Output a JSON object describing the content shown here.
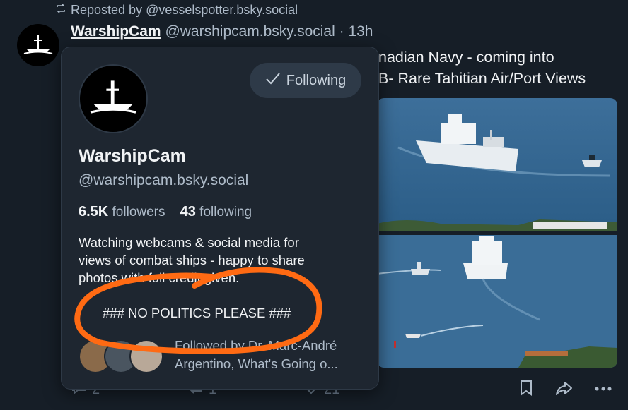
{
  "repost": {
    "label": "Reposted by @vesselspotter.bsky.social"
  },
  "post": {
    "display_name": "WarshipCam",
    "handle": "@warshipcam.bsky.social",
    "time": "· 13h",
    "text_line1": "nadian Navy - coming into",
    "text_line2": "B- Rare Tahitian Air/Port Views",
    "reply_count": "2",
    "repost_count": "1",
    "like_count": "21"
  },
  "profile_card": {
    "follow_label": "Following",
    "display_name": "WarshipCam",
    "handle": "@warshipcam.bsky.social",
    "followers_count": "6.5K",
    "followers_label": "followers",
    "following_count": "43",
    "following_label": "following",
    "bio_line1": "Watching webcams & social media for",
    "bio_line2": "views of combat ships - happy to share",
    "bio_line3": "photos with full credit given.",
    "bio_line4": "### NO POLITICS PLEASE ###",
    "followed_by_line1": "Followed by Dr. Marc-André",
    "followed_by_line2": "Argentino, What's Going o..."
  },
  "colors": {
    "background": "#161e27",
    "card": "#1e2630",
    "annotation": "#ff6a13"
  },
  "icons": [
    "repost-icon",
    "checkmark-icon",
    "reply-icon",
    "like-icon",
    "bookmark-icon",
    "share-icon",
    "more-icon"
  ]
}
